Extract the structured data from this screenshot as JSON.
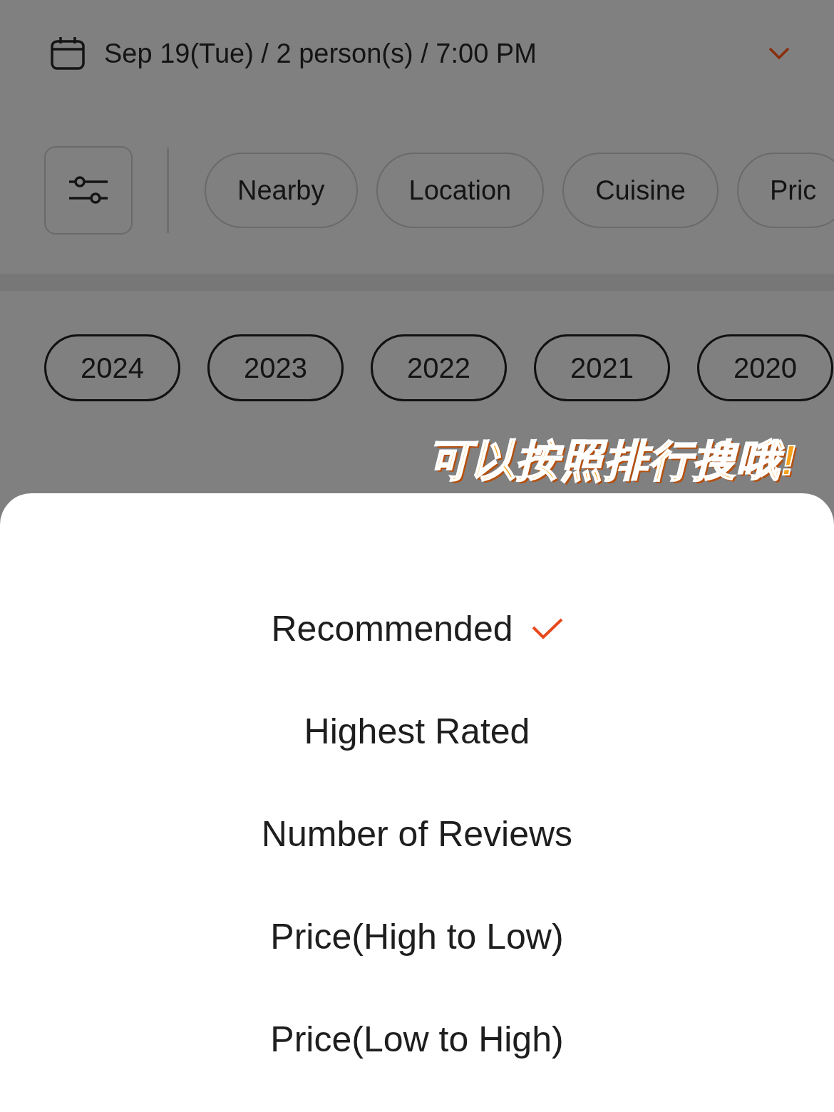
{
  "booking": {
    "summary": "Sep 19(Tue) / 2 person(s) / 7:00 PM"
  },
  "filters": [
    {
      "label": "Nearby"
    },
    {
      "label": "Location"
    },
    {
      "label": "Cuisine"
    },
    {
      "label": "Pric"
    }
  ],
  "years": [
    {
      "label": "2024"
    },
    {
      "label": "2023"
    },
    {
      "label": "2022"
    },
    {
      "label": "2021"
    },
    {
      "label": "2020"
    }
  ],
  "sticker": "可以按照排行搜哦!",
  "sort_sheet": {
    "options": [
      {
        "label": "Recommended",
        "selected": true
      },
      {
        "label": "Highest Rated",
        "selected": false
      },
      {
        "label": "Number of Reviews",
        "selected": false
      },
      {
        "label": "Price(High to Low)",
        "selected": false
      },
      {
        "label": "Price(Low to High)",
        "selected": false
      }
    ]
  }
}
